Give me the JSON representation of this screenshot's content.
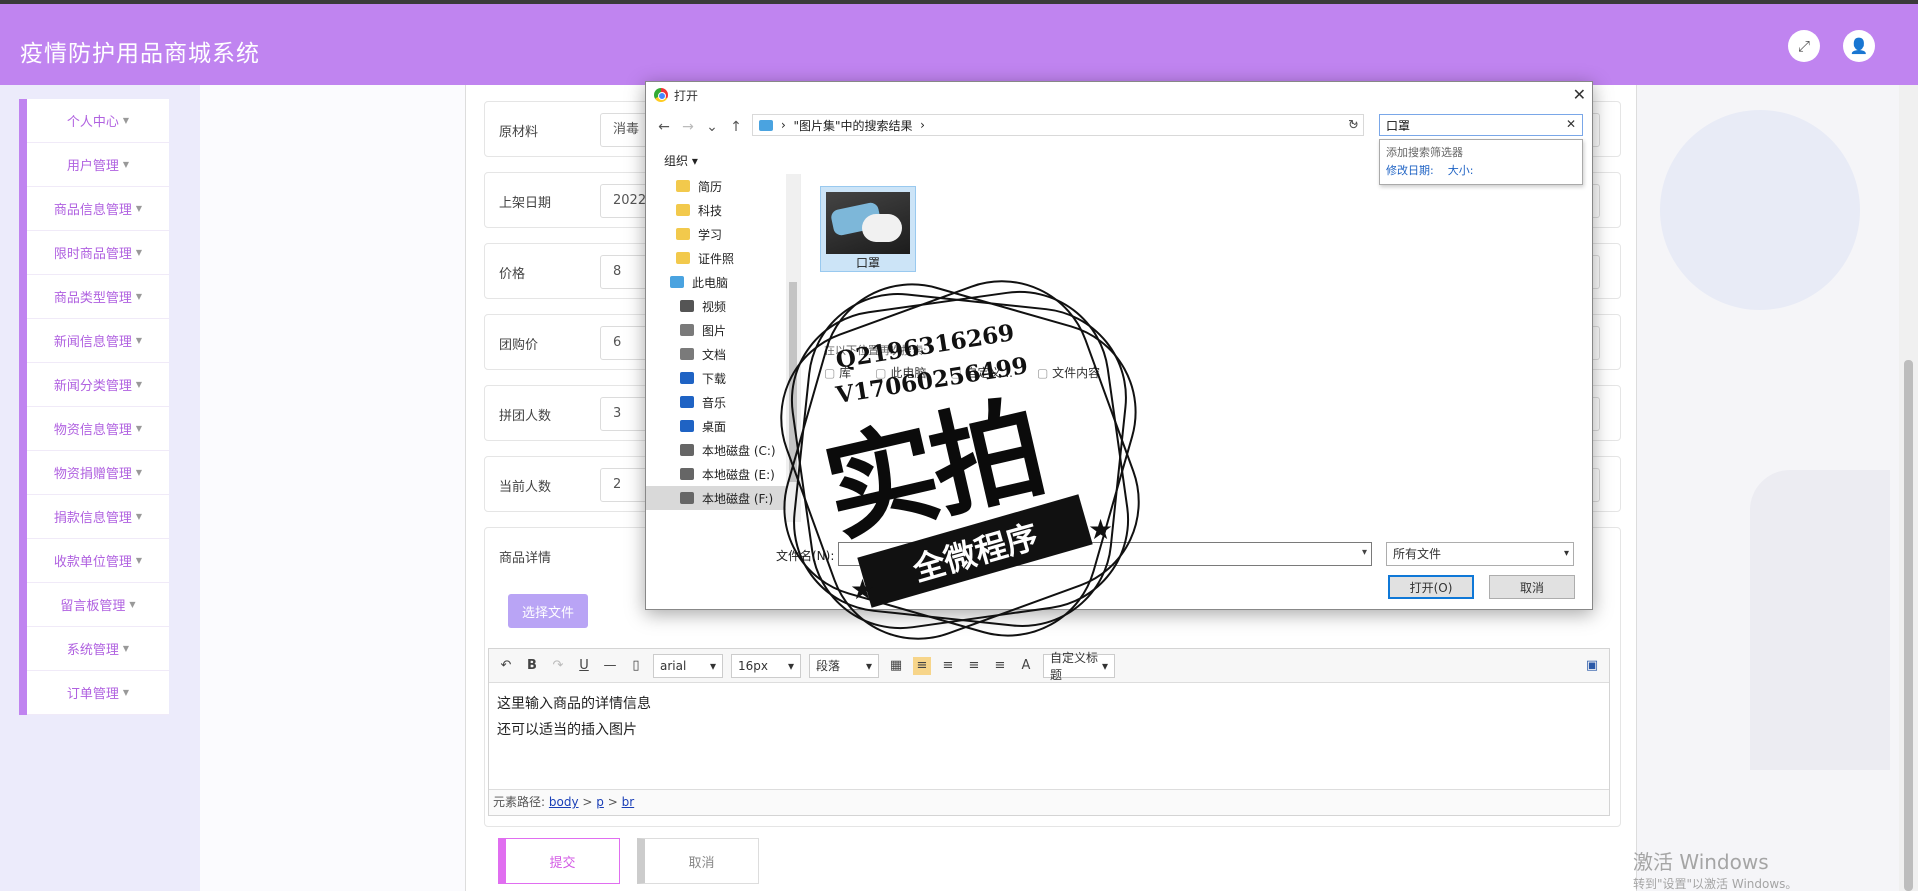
{
  "app": {
    "title": "疫情防护用品商城系统"
  },
  "header": {
    "fullscreen_icon": "fullscreen-icon",
    "user_icon": "user-icon"
  },
  "sidebar": {
    "items": [
      {
        "label": "个人中心"
      },
      {
        "label": "用户管理"
      },
      {
        "label": "商品信息管理"
      },
      {
        "label": "限时商品管理"
      },
      {
        "label": "商品类型管理"
      },
      {
        "label": "新闻信息管理"
      },
      {
        "label": "新闻分类管理"
      },
      {
        "label": "物资信息管理"
      },
      {
        "label": "物资捐赠管理"
      },
      {
        "label": "捐款信息管理"
      },
      {
        "label": "收款单位管理"
      },
      {
        "label": "留言板管理"
      },
      {
        "label": "系统管理"
      },
      {
        "label": "订单管理"
      }
    ]
  },
  "form": {
    "rows": [
      {
        "label": "原材料",
        "value": "消毒"
      },
      {
        "label": "上架日期",
        "value": "2022"
      },
      {
        "label": "价格",
        "value": "8"
      },
      {
        "label": "团购价",
        "value": "6"
      },
      {
        "label": "拼团人数",
        "value": "3"
      },
      {
        "label": "当前人数",
        "value": "2"
      }
    ],
    "detail_label": "商品详情",
    "choose_file": "选择文件",
    "submit": "提交",
    "cancel": "取消"
  },
  "editor": {
    "font": "arial",
    "size": "16px",
    "paragraph": "段落",
    "custom_title": "自定义标题",
    "line1": "这里输入商品的详情信息",
    "line2": "还可以适当的插入图片",
    "path_label": "元素路径:",
    "path": [
      "body",
      "p",
      "br"
    ],
    "path_sep": ">"
  },
  "dialog": {
    "title": "打开",
    "address": "\"图片集\"中的搜索结果",
    "address_sep": "›",
    "search_value": "口罩",
    "suggest_title": "添加搜索筛选器",
    "suggest_date": "修改日期:",
    "suggest_size": "大小:",
    "organize": "组织",
    "tree": [
      {
        "label": "简历",
        "color": "#f2c94c"
      },
      {
        "label": "科技",
        "color": "#f2c94c"
      },
      {
        "label": "学习",
        "color": "#f2c94c"
      },
      {
        "label": "证件照",
        "color": "#f2c94c"
      },
      {
        "label": "此电脑",
        "color": "#4aa3e0"
      },
      {
        "label": "视频",
        "color": "#555555"
      },
      {
        "label": "图片",
        "color": "#7a7a7a"
      },
      {
        "label": "文档",
        "color": "#7a7a7a"
      },
      {
        "label": "下载",
        "color": "#1f63c4"
      },
      {
        "label": "音乐",
        "color": "#1f63c4"
      },
      {
        "label": "桌面",
        "color": "#1f63c4"
      },
      {
        "label": "本地磁盘 (C:)",
        "color": "#666666"
      },
      {
        "label": "本地磁盘 (E:)",
        "color": "#666666"
      },
      {
        "label": "本地磁盘 (F:)",
        "color": "#666666"
      }
    ],
    "file_name_shown": "口罩",
    "search_again_caption": "在以下位置再次搜索:",
    "locations": [
      "库",
      "此电脑",
      "自定义...",
      "文件内容"
    ],
    "filename_label": "文件名(N):",
    "filetype": "所有文件",
    "open_button": "打开(O)",
    "cancel_button": "取消"
  },
  "stamp": {
    "phone1": "Q2196316269",
    "phone2": "V17060256499",
    "main": "实拍",
    "banner": "全微程序"
  },
  "watermark": {
    "line1": "激活 Windows",
    "line2": "转到\"设置\"以激活 Windows。"
  }
}
